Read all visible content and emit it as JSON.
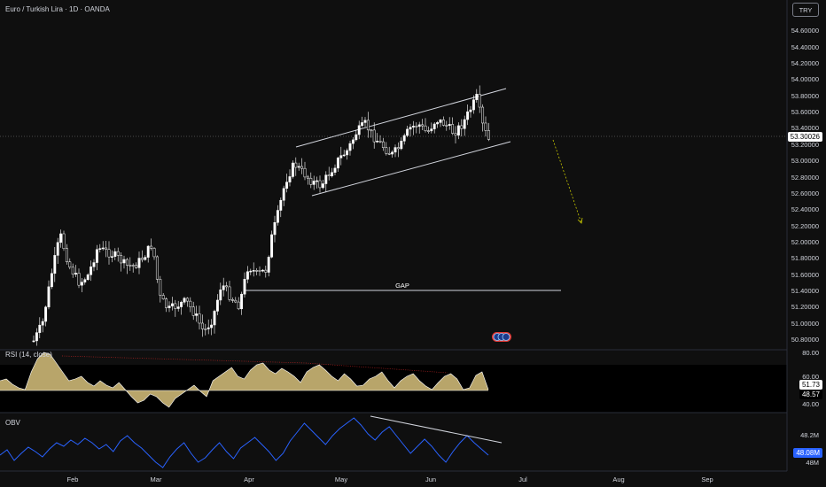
{
  "header": {
    "symbol_title": "Euro / Turkish Lira · 1D · OANDA",
    "currency": "TRY"
  },
  "price_axis": {
    "labels": [
      "54.60000",
      "54.40000",
      "54.20000",
      "54.00000",
      "53.80000",
      "53.60000",
      "53.40000",
      "53.20000",
      "53.00000",
      "52.80000",
      "52.60000",
      "52.40000",
      "52.20000",
      "52.00000",
      "51.80000",
      "51.60000",
      "51.40000",
      "51.20000",
      "51.00000",
      "50.80000"
    ],
    "current_price": "53.30026"
  },
  "annotations": {
    "gap_label": "GAP"
  },
  "rsi_panel": {
    "title": "RSI (14, close)",
    "axis_labels": [
      "80.00",
      "60.00",
      "40.00"
    ],
    "current_value": "51.73",
    "ma_value": "48.57"
  },
  "obv_panel": {
    "title": "OBV",
    "axis_labels": [
      "48.2M",
      "48M"
    ],
    "current_value": "48.08M"
  },
  "time_axis": {
    "labels": [
      "Feb",
      "Mar",
      "Apr",
      "May",
      "Jun",
      "Jul",
      "Aug",
      "Sep"
    ]
  },
  "colors": {
    "background": "#0f0f0f",
    "candle": "#ffffff",
    "rsi_fill": "#b8a56a",
    "obv_line": "#2962ff",
    "current_price_tag": "#ffffff",
    "obv_tag": "#2962ff",
    "projection": "#c8c800"
  }
}
